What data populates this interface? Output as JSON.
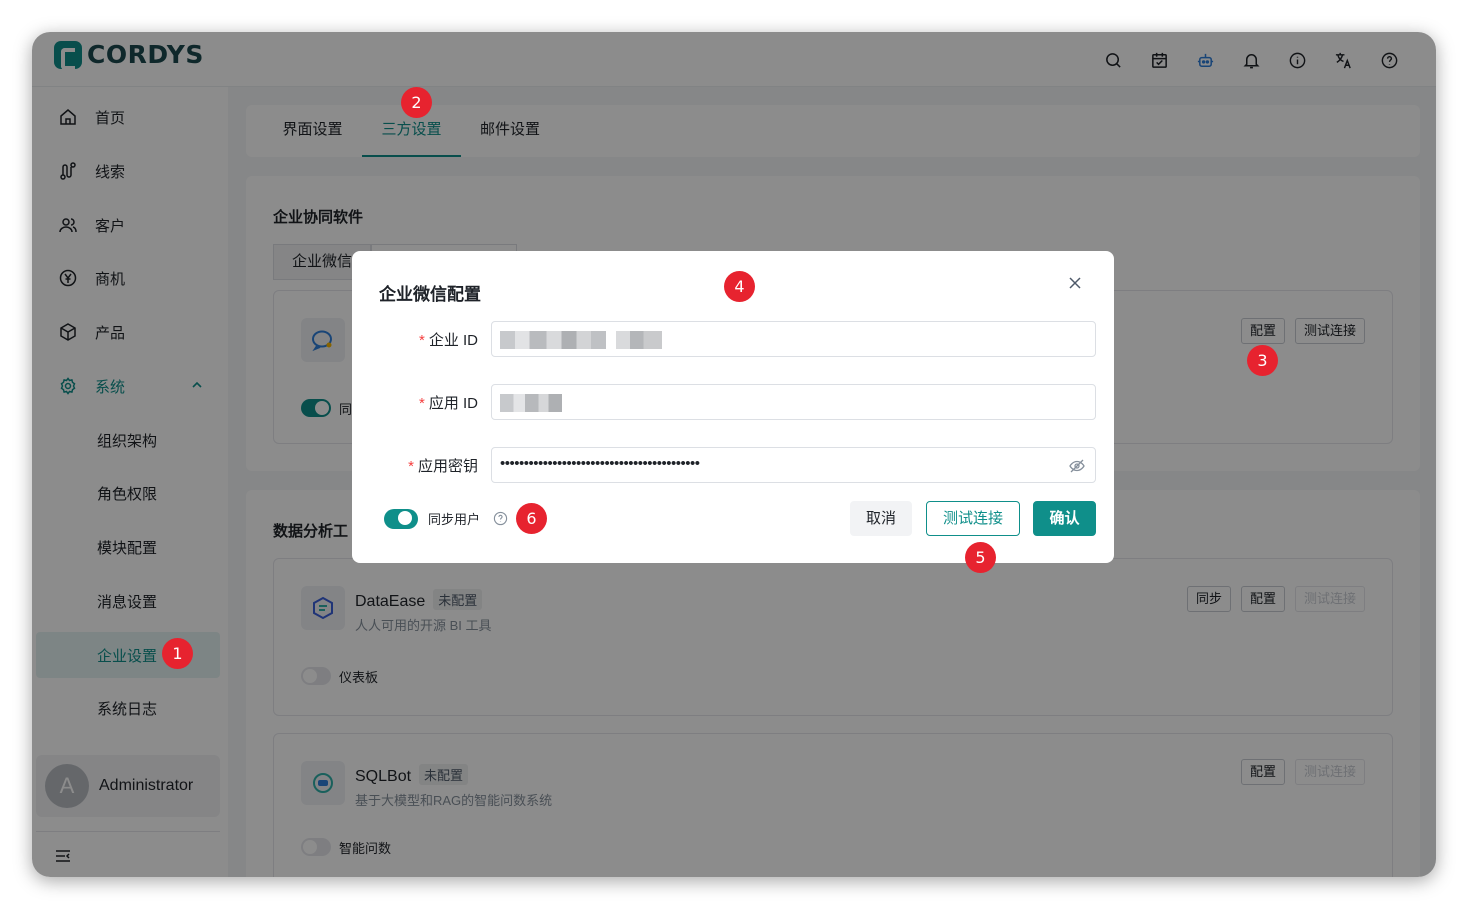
{
  "app": {
    "brand": "CORDYS"
  },
  "header_icons": [
    "search-icon",
    "calendar-icon",
    "robot-icon",
    "bell-icon",
    "info-icon",
    "translate-icon",
    "help-icon"
  ],
  "sidebar": {
    "items": [
      {
        "label": "首页",
        "icon": "home-icon"
      },
      {
        "label": "线索",
        "icon": "route-icon"
      },
      {
        "label": "客户",
        "icon": "users-icon"
      },
      {
        "label": "商机",
        "icon": "yen-icon"
      },
      {
        "label": "产品",
        "icon": "box-icon"
      },
      {
        "label": "系统",
        "icon": "gear-icon"
      }
    ],
    "sub_items": [
      {
        "label": "组织架构"
      },
      {
        "label": "角色权限"
      },
      {
        "label": "模块配置"
      },
      {
        "label": "消息设置"
      },
      {
        "label": "企业设置"
      },
      {
        "label": "系统日志"
      }
    ],
    "user": {
      "avatar_letter": "A",
      "name": "Administrator"
    }
  },
  "tabs": [
    {
      "label": "界面设置"
    },
    {
      "label": "三方设置"
    },
    {
      "label": "邮件设置"
    }
  ],
  "collab": {
    "title": "企业协同软件",
    "segments": [
      "企业微信",
      ""
    ],
    "config_button": "配置",
    "test_button": "测试连接",
    "switch_label": "同"
  },
  "analytics": {
    "title": "数据分析工",
    "apps": [
      {
        "name": "DataEase",
        "badge": "未配置",
        "desc": "人人可用的开源 BI 工具",
        "sync_button": "同步",
        "config_button": "配置",
        "test_button": "测试连接",
        "switch_label": "仪表板",
        "switch_on": false
      },
      {
        "name": "SQLBot",
        "badge": "未配置",
        "desc": "基于大模型和RAG的智能问数系统",
        "config_button": "配置",
        "test_button": "测试连接",
        "switch_label": "智能问数",
        "switch_on": false
      }
    ]
  },
  "modal": {
    "title": "企业微信配置",
    "fields": [
      {
        "label": "企业 ID",
        "required": true,
        "value_hidden": true
      },
      {
        "label": "应用 ID",
        "required": true,
        "value_hidden": true
      },
      {
        "label": "应用密钥",
        "required": true,
        "value": "••••••••••••••••••••••••••••••••••••••••••"
      }
    ],
    "sync_label": "同步用户",
    "sync_on": true,
    "cancel": "取消",
    "test": "测试连接",
    "confirm": "确认"
  },
  "markers": [
    "1",
    "2",
    "3",
    "4",
    "5",
    "6"
  ],
  "colors": {
    "accent": "#0f8f8a",
    "marker": "#e7232f",
    "selected_bg": "#e3f3f2"
  }
}
